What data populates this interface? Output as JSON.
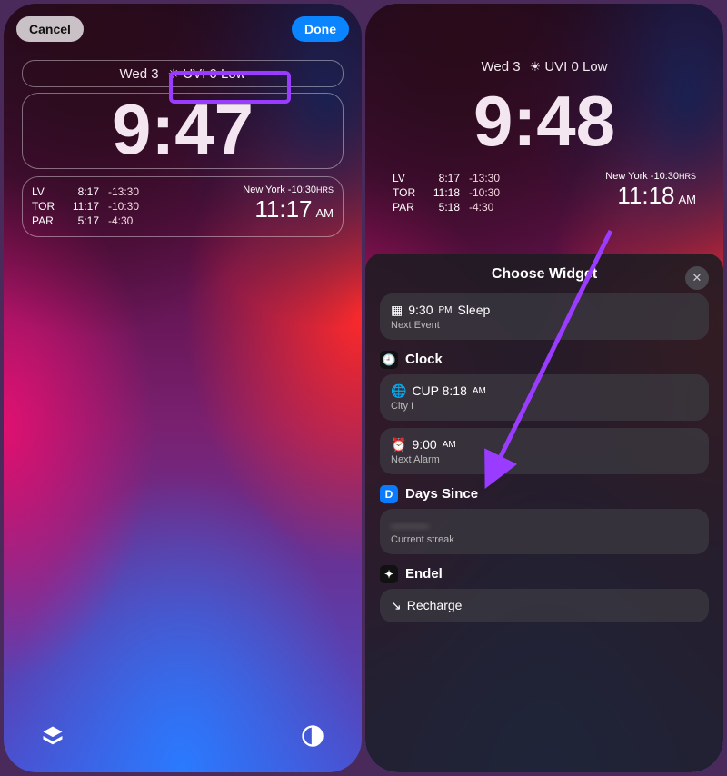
{
  "left": {
    "cancel": "Cancel",
    "done": "Done",
    "date": "Wed 3",
    "uvi": "UVI 0 Low",
    "time": "9:47",
    "cities": [
      {
        "code": "LV",
        "t": "8:17",
        "off": "-13:30"
      },
      {
        "code": "TOR",
        "t": "11:17",
        "off": "-10:30"
      },
      {
        "code": "PAR",
        "t": "5:17",
        "off": "-4:30"
      }
    ],
    "ny_label": "New York -10:30",
    "ny_time": "11:17",
    "ny_ampm": "AM"
  },
  "right": {
    "date": "Wed 3",
    "uvi": "UVI 0 Low",
    "time": "9:48",
    "cities": [
      {
        "code": "LV",
        "t": "8:17",
        "off": "-13:30"
      },
      {
        "code": "TOR",
        "t": "11:18",
        "off": "-10:30"
      },
      {
        "code": "PAR",
        "t": "5:18",
        "off": "-4:30"
      }
    ],
    "ny_label": "New York -10:30",
    "ny_time": "11:18",
    "ny_ampm": "AM",
    "sheet": {
      "title": "Choose Widget",
      "sleep_time": "9:30",
      "sleep_pm": "PM",
      "sleep_label": "Sleep",
      "sleep_sub": "Next Event",
      "clock_label": "Clock",
      "cup": "CUP 8:18",
      "cup_am": "AM",
      "cup_sub": "City I",
      "alarm": "9:00",
      "alarm_am": "AM",
      "alarm_sub": "Next Alarm",
      "days_label": "Days Since",
      "days_sub": "Current streak",
      "endel_label": "Endel",
      "endel_item": "Recharge"
    }
  }
}
